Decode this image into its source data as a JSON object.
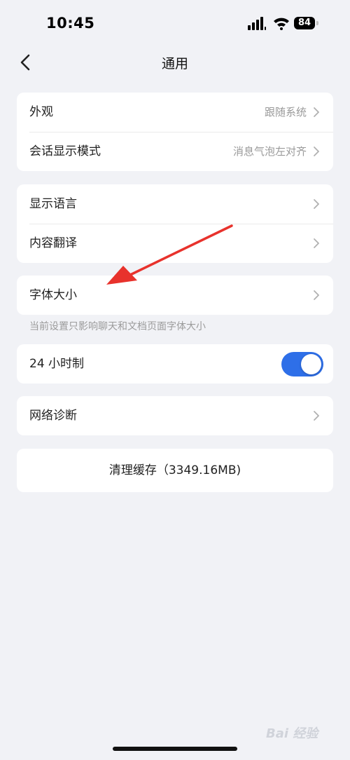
{
  "status_bar": {
    "time": "10:45",
    "battery": "84",
    "icons": [
      "signal-icon",
      "wifi-icon",
      "battery-icon"
    ]
  },
  "nav": {
    "title": "通用",
    "back_icon": "chevron-left-icon"
  },
  "group1": {
    "items": [
      {
        "label": "外观",
        "value": "跟随系统"
      },
      {
        "label": "会话显示模式",
        "value": "消息气泡左对齐"
      }
    ]
  },
  "group2": {
    "items": [
      {
        "label": "显示语言"
      },
      {
        "label": "内容翻译"
      }
    ]
  },
  "font_size": {
    "label": "字体大小",
    "hint": "当前设置只影响聊天和文档页面字体大小"
  },
  "clock": {
    "label": "24 小时制",
    "enabled": true
  },
  "network": {
    "label": "网络诊断"
  },
  "clear_cache": {
    "label": "清理缓存（3349.16MB)"
  },
  "annotation": {
    "arrow_color": "#e8322c"
  },
  "watermark": {
    "text": "Bai 经验"
  },
  "colors": {
    "toggle_on": "#2e6fe8",
    "background": "#f1f2f6"
  }
}
